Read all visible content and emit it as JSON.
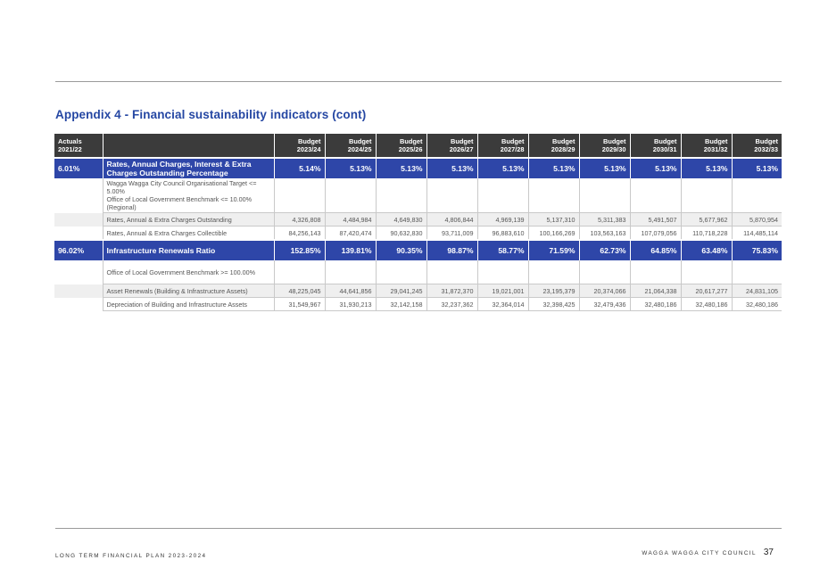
{
  "title": "Appendix 4 - Financial sustainability indicators (cont)",
  "header": {
    "actuals_line1": "Actuals",
    "actuals_line2": "2021/22",
    "budget_word": "Budget",
    "years": [
      "2023/24",
      "2024/25",
      "2025/26",
      "2026/27",
      "2027/28",
      "2028/29",
      "2029/30",
      "2030/31",
      "2031/32",
      "2032/33"
    ]
  },
  "rates_indicator": {
    "actual": "6.01%",
    "label": "Rates, Annual Charges, Interest & Extra Charges Outstanding Percentage",
    "values": [
      "5.14%",
      "5.13%",
      "5.13%",
      "5.13%",
      "5.13%",
      "5.13%",
      "5.13%",
      "5.13%",
      "5.13%",
      "5.13%"
    ],
    "benchmark": "Wagga Wagga City Council Organisational Target <= 5.00%\nOffice of Local Government Benchmark <= 10.00% (Regional)",
    "rows": [
      {
        "label": "Rates, Annual & Extra Charges Outstanding",
        "values": [
          "4,326,808",
          "4,484,984",
          "4,649,830",
          "4,806,844",
          "4,969,139",
          "5,137,310",
          "5,311,383",
          "5,491,507",
          "5,677,962",
          "5,870,954"
        ]
      },
      {
        "label": "Rates, Annual & Extra Charges Collectible",
        "values": [
          "84,256,143",
          "87,420,474",
          "90,632,830",
          "93,711,009",
          "96,883,610",
          "100,166,269",
          "103,563,163",
          "107,079,056",
          "110,718,228",
          "114,485,114"
        ]
      }
    ]
  },
  "renewals_indicator": {
    "actual": "96.02%",
    "label": "Infrastructure Renewals Ratio",
    "values": [
      "152.85%",
      "139.81%",
      "90.35%",
      "98.87%",
      "58.77%",
      "71.59%",
      "62.73%",
      "64.85%",
      "63.48%",
      "75.83%"
    ],
    "benchmark": "Office of Local Government Benchmark >= 100.00%",
    "rows": [
      {
        "label": "Asset Renewals (Building & Infrastructure Assets)",
        "values": [
          "48,225,045",
          "44,641,856",
          "29,041,245",
          "31,872,370",
          "19,021,001",
          "23,195,379",
          "20,374,066",
          "21,064,338",
          "20,617,277",
          "24,831,105"
        ]
      },
      {
        "label": "Depreciation of Building and Infrastructure Assets",
        "values": [
          "31,549,967",
          "31,930,213",
          "32,142,158",
          "32,237,362",
          "32,364,014",
          "32,398,425",
          "32,479,436",
          "32,480,186",
          "32,480,186",
          "32,480,186"
        ]
      }
    ]
  },
  "footer": {
    "left": "LONG TERM FINANCIAL PLAN 2023-2024",
    "right": "WAGGA WAGGA CITY COUNCIL",
    "page": "37"
  },
  "colors": {
    "header_bg": "#3b3b3b",
    "indicator_bg": "#2e46a8",
    "title": "#2547a3",
    "row_shade": "#efefef"
  }
}
